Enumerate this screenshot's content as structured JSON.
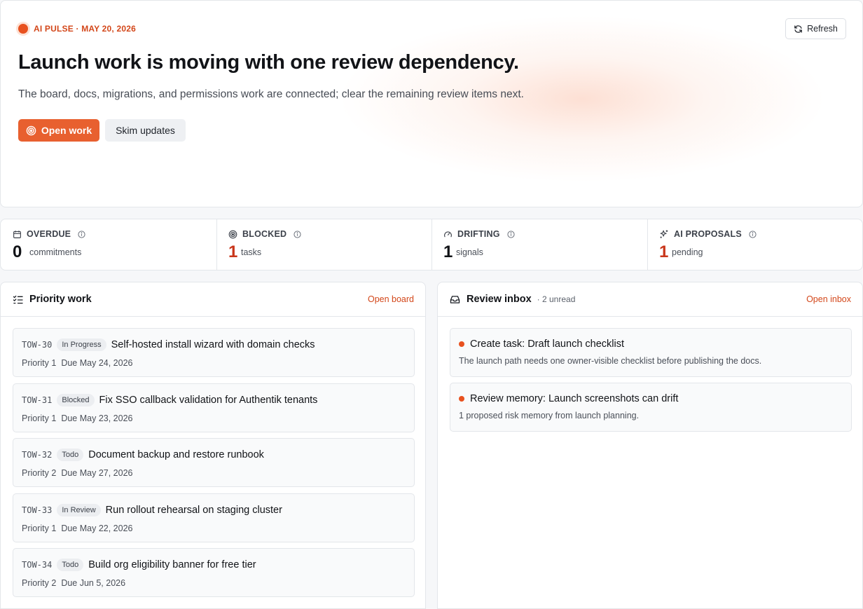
{
  "colors": {
    "accent": "#e8602f",
    "accent_text": "#d3471a",
    "alert": "#c9361b"
  },
  "hero": {
    "pulse_label": "AI PULSE · MAY 20, 2026",
    "title": "Launch work is moving with one review dependency.",
    "subtitle": "The board, docs, migrations, and permissions work are connected; clear the remaining review items next.",
    "primary_button": "Open work",
    "secondary_button": "Skim updates",
    "refresh_button": "Refresh"
  },
  "stats": [
    {
      "icon": "calendar-icon",
      "label": "OVERDUE",
      "value": "0",
      "unit": "commitments"
    },
    {
      "icon": "target-icon",
      "label": "BLOCKED",
      "value": "1",
      "unit": "tasks"
    },
    {
      "icon": "gauge-icon",
      "label": "DRIFTING",
      "value": "1",
      "unit": "signals"
    },
    {
      "icon": "sparkles-icon",
      "label": "AI PROPOSALS",
      "value": "1",
      "unit": "pending"
    }
  ],
  "priority": {
    "title": "Priority work",
    "link": "Open board",
    "tasks": [
      {
        "id": "TOW-30",
        "status": "In Progress",
        "title": "Self-hosted install wizard with domain checks",
        "priority": "Priority 1",
        "due": "Due May 24, 2026"
      },
      {
        "id": "TOW-31",
        "status": "Blocked",
        "title": "Fix SSO callback validation for Authentik tenants",
        "priority": "Priority 1",
        "due": "Due May 23, 2026"
      },
      {
        "id": "TOW-32",
        "status": "Todo",
        "title": "Document backup and restore runbook",
        "priority": "Priority 2",
        "due": "Due May 27, 2026"
      },
      {
        "id": "TOW-33",
        "status": "In Review",
        "title": "Run rollout rehearsal on staging cluster",
        "priority": "Priority 1",
        "due": "Due May 22, 2026"
      },
      {
        "id": "TOW-34",
        "status": "Todo",
        "title": "Build org eligibility banner for free tier",
        "priority": "Priority 2",
        "due": "Due Jun 5, 2026"
      }
    ]
  },
  "inbox": {
    "title": "Review inbox",
    "meta": "· 2 unread",
    "link": "Open inbox",
    "items": [
      {
        "title": "Create task: Draft launch checklist",
        "description": "The launch path needs one owner-visible checklist before publishing the docs."
      },
      {
        "title": "Review memory: Launch screenshots can drift",
        "description": "1 proposed risk memory from launch planning."
      }
    ]
  }
}
